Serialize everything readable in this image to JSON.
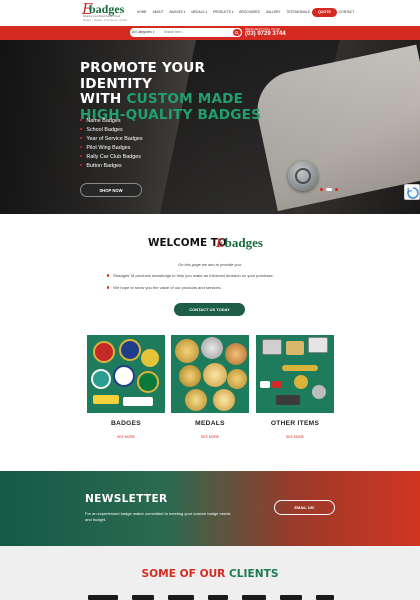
{
  "header": {
    "logo": {
      "mark": "E",
      "word": "badges",
      "tagline": "Wearing your Brand Name Proud",
      "tagline2": "Badges · Medals · Promotional · Quality"
    },
    "nav": [
      {
        "label": "Home",
        "caret": false
      },
      {
        "label": "About",
        "caret": false
      },
      {
        "label": "Badges",
        "caret": true
      },
      {
        "label": "Medals",
        "caret": true
      },
      {
        "label": "Products",
        "caret": true
      },
      {
        "label": "Brochures",
        "caret": false
      },
      {
        "label": "Gallery",
        "caret": false
      },
      {
        "label": "Testimonials",
        "caret": false
      },
      {
        "label": "Ordering",
        "caret": false
      },
      {
        "label": "Contact",
        "caret": false
      }
    ],
    "quote_label": "QUOTE"
  },
  "topbar": {
    "category_select": "All Categories",
    "search_placeholder": "Search here...",
    "phone_label": "NEED HELP? CALL US ON",
    "phone_number": "(03) 9729 3744",
    "colors": {
      "red": "#d42a20",
      "green": "#1d7a55"
    }
  },
  "hero": {
    "title_line1": "PROMOTE YOUR IDENTITY",
    "title_line2_plain": "WITH ",
    "title_line2_accent": "CUSTOM MADE",
    "title_line3": "HIGH-QUALITY BADGES",
    "list": [
      "Name Badges",
      "School Badges",
      "Year of Service Badges",
      "Pilot Wing Badges",
      "Rally Car Club Badges",
      "Button Badges"
    ],
    "cta": "SHOP NOW"
  },
  "welcome": {
    "title": "WELCOME TO",
    "logo_mark": "E",
    "logo_word": "badges",
    "subtitle": "On this page we aim to provide you:",
    "points": [
      "Ebadges' M products knowledge to help you make an informed decision on your purchase.",
      "We hope to show you the value of our products and services."
    ],
    "cta": "CONTACT US TODAY"
  },
  "products": [
    {
      "label": "BADGES",
      "more": "SEE MORE"
    },
    {
      "label": "MEDALS",
      "more": "SEE MORE"
    },
    {
      "label": "OTHER ITEMS",
      "more": "SEE MORE"
    }
  ],
  "newsletter": {
    "title": "NEWSLETTER",
    "text": "For an experienced badge maker committed to meeting your custom badge needs and budget.",
    "cta": "EMAIL US!"
  },
  "clients": {
    "title_plain": "SOME OF OUR ",
    "title_accent": "CLIENTS"
  }
}
